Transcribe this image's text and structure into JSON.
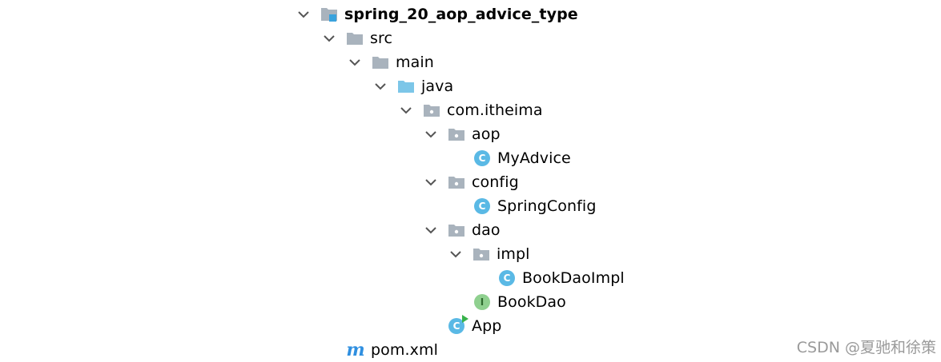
{
  "tree": {
    "project": {
      "label": "spring_20_aop_advice_type",
      "icon": "project-folder-icon"
    },
    "src": {
      "label": "src",
      "icon": "folder-icon"
    },
    "main": {
      "label": "main",
      "icon": "folder-icon"
    },
    "java": {
      "label": "java",
      "icon": "source-root-folder-icon"
    },
    "com_itheima": {
      "label": "com.itheima",
      "icon": "package-icon"
    },
    "aop": {
      "label": "aop",
      "icon": "package-icon"
    },
    "my_advice": {
      "label": "MyAdvice",
      "icon": "class-icon",
      "badge": "C"
    },
    "config": {
      "label": "config",
      "icon": "package-icon"
    },
    "spring_config": {
      "label": "SpringConfig",
      "icon": "class-icon",
      "badge": "C"
    },
    "dao": {
      "label": "dao",
      "icon": "package-icon"
    },
    "impl": {
      "label": "impl",
      "icon": "package-icon"
    },
    "book_dao_impl": {
      "label": "BookDaoImpl",
      "icon": "class-icon",
      "badge": "C"
    },
    "book_dao": {
      "label": "BookDao",
      "icon": "interface-icon",
      "badge": "I"
    },
    "app": {
      "label": "App",
      "icon": "runnable-class-icon",
      "badge": "C"
    },
    "pom": {
      "label": "pom.xml",
      "icon": "maven-icon",
      "badge": "m"
    }
  },
  "watermark": "CSDN @夏驰和徐策",
  "colors": {
    "folder": "#a9b3bd",
    "source_root": "#7cc6e8",
    "class": "#5ab9e5",
    "interface": "#8fd08f",
    "run": "#38b24a",
    "maven": "#2f8fe0"
  }
}
